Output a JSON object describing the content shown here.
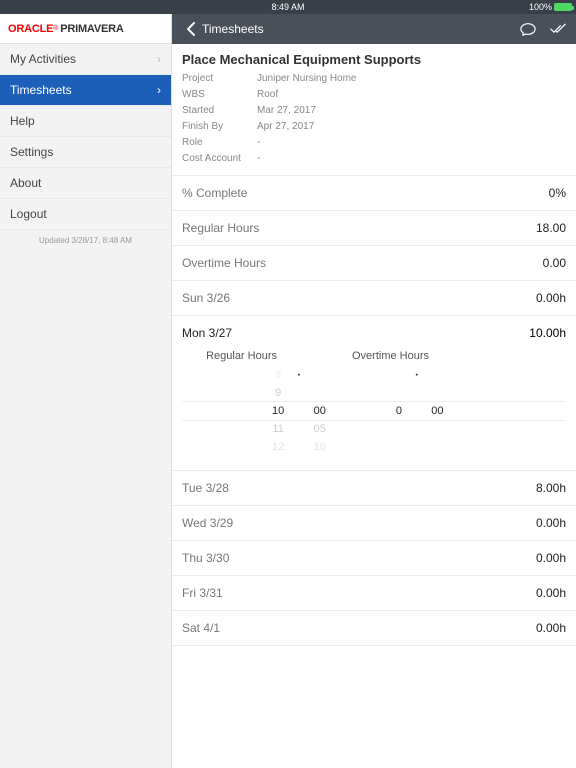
{
  "status": {
    "time": "8:49 AM",
    "batteryText": "100%"
  },
  "brand": {
    "oracle": "ORACLE",
    "primavera": "PRIMAVERA"
  },
  "sidebar": {
    "items": [
      {
        "label": "My Activities",
        "chev": true
      },
      {
        "label": "Timesheets",
        "chev": true,
        "active": true
      },
      {
        "label": "Help"
      },
      {
        "label": "Settings"
      },
      {
        "label": "About"
      },
      {
        "label": "Logout"
      }
    ],
    "updated": "Updated 3/28/17, 8:48 AM"
  },
  "topbar": {
    "back": "Timesheets"
  },
  "activity": {
    "title": "Place Mechanical Equipment Supports",
    "meta": [
      {
        "label": "Project",
        "value": "Juniper Nursing Home"
      },
      {
        "label": "WBS",
        "value": "Roof"
      },
      {
        "label": "Started",
        "value": "Mar 27, 2017"
      },
      {
        "label": "Finish By",
        "value": "Apr 27, 2017"
      },
      {
        "label": "Role",
        "value": "-"
      },
      {
        "label": "Cost Account",
        "value": "-"
      }
    ]
  },
  "summary": [
    {
      "label": "% Complete",
      "value": "0%"
    },
    {
      "label": "Regular Hours",
      "value": "18.00"
    },
    {
      "label": "Overtime Hours",
      "value": "0.00"
    }
  ],
  "days": [
    {
      "label": "Sun 3/26",
      "value": "0.00h"
    },
    {
      "label": "Mon 3/27",
      "value": "10.00h",
      "expanded": true
    },
    {
      "label": "Tue 3/28",
      "value": "8.00h"
    },
    {
      "label": "Wed 3/29",
      "value": "0.00h"
    },
    {
      "label": "Thu 3/30",
      "value": "0.00h"
    },
    {
      "label": "Fri 3/31",
      "value": "0.00h"
    },
    {
      "label": "Sat 4/1",
      "value": "0.00h"
    }
  ],
  "picker": {
    "headers": [
      "Regular Hours",
      "Overtime Hours"
    ],
    "regular": {
      "hoursAbove2": "8",
      "hoursAbove": "9",
      "hours": "10",
      "hoursBelow": "11",
      "hoursBelow2": "12",
      "minutes": "00",
      "minBelow": "05",
      "minBelow2": "10"
    },
    "overtime": {
      "hours": "0",
      "minutes": "00"
    },
    "dot": "·"
  }
}
